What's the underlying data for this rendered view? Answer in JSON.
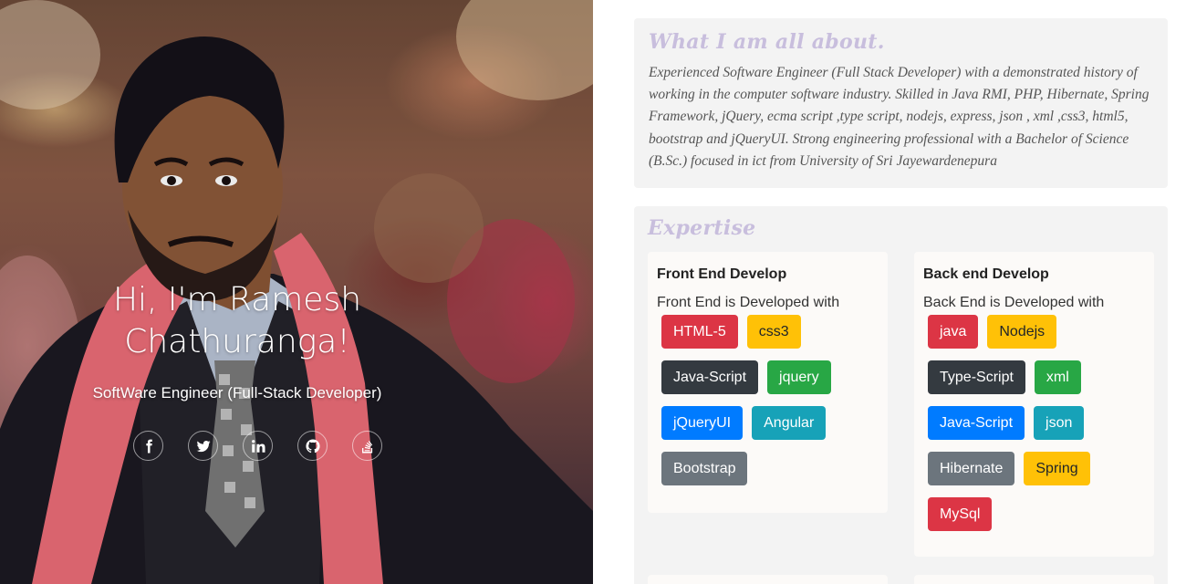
{
  "hero": {
    "name": "Hi, I'm Ramesh Chathuranga!",
    "role": "SoftWare Engineer (Full-Stack Developer)",
    "socials": [
      {
        "icon": "facebook-icon"
      },
      {
        "icon": "twitter-icon"
      },
      {
        "icon": "linkedin-icon"
      },
      {
        "icon": "github-icon"
      },
      {
        "icon": "stackoverflow-icon"
      }
    ]
  },
  "about": {
    "title": "What I am all about.",
    "text": "Experienced Software Engineer (Full Stack Developer) with a demonstrated history of working in the computer software industry. Skilled in Java RMI, PHP, Hibernate, Spring Framework, jQuery, ecma script ,type script, nodejs, express, json , xml ,css3, html5, bootstrap and jQueryUI. Strong engineering professional with a Bachelor of Science (B.Sc.) focused in ict from University of Sri Jayewardenepura"
  },
  "expertise": {
    "title": "Expertise",
    "front": {
      "title": "Front End Develop",
      "subtitle": "Front End is Developed with",
      "badges": [
        {
          "label": "HTML-5",
          "color": "#dc3545"
        },
        {
          "label": "css3",
          "color": "#ffc107"
        },
        {
          "label": "Java-Script",
          "color": "#343a40"
        },
        {
          "label": "jquery",
          "color": "#28a745"
        },
        {
          "label": "jQueryUI",
          "color": "#007bff"
        },
        {
          "label": "Angular",
          "color": "#17a2b8"
        },
        {
          "label": "Bootstrap",
          "color": "#6c757d"
        }
      ]
    },
    "back": {
      "title": "Back end Develop",
      "subtitle": "Back End is Developed with",
      "badges": [
        {
          "label": "java",
          "color": "#dc3545"
        },
        {
          "label": "Nodejs",
          "color": "#ffc107"
        },
        {
          "label": "Type-Script",
          "color": "#343a40"
        },
        {
          "label": "xml",
          "color": "#28a745"
        },
        {
          "label": "Java-Script",
          "color": "#007bff"
        },
        {
          "label": "json",
          "color": "#17a2b8"
        },
        {
          "label": "Hibernate",
          "color": "#6c757d"
        },
        {
          "label": "Spring",
          "color": "#ffc107"
        },
        {
          "label": "MySql",
          "color": "#dc3545"
        }
      ]
    }
  }
}
